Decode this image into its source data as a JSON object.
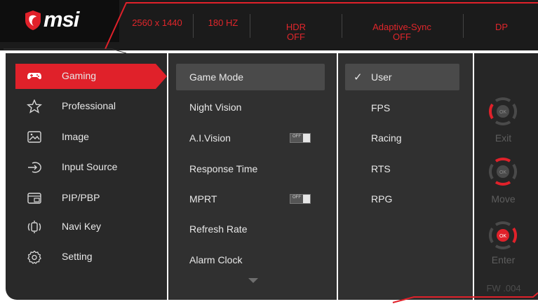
{
  "brand": {
    "logo_text": "msi",
    "accent_color": "#e0212a"
  },
  "header": {
    "specs": [
      {
        "line1": "2560 x 1440",
        "line2": ""
      },
      {
        "line1": "180 HZ",
        "line2": ""
      },
      {
        "line1": "HDR",
        "line2": "OFF"
      },
      {
        "line1": "Adaptive-Sync",
        "line2": "OFF"
      },
      {
        "line1": "DP",
        "line2": ""
      }
    ]
  },
  "main_menu": {
    "items": [
      {
        "label": "Gaming",
        "icon": "gamepad-icon",
        "active": true
      },
      {
        "label": "Professional",
        "icon": "star-icon",
        "active": false
      },
      {
        "label": "Image",
        "icon": "image-icon",
        "active": false
      },
      {
        "label": "Input Source",
        "icon": "input-source-icon",
        "active": false
      },
      {
        "label": "PIP/PBP",
        "icon": "pip-icon",
        "active": false
      },
      {
        "label": "Navi Key",
        "icon": "navi-key-icon",
        "active": false
      },
      {
        "label": "Setting",
        "icon": "gear-icon",
        "active": false
      }
    ]
  },
  "submenu": {
    "items": [
      {
        "label": "Game Mode",
        "selected": true
      },
      {
        "label": "Night Vision"
      },
      {
        "label": "A.I.Vision",
        "toggle": "OFF"
      },
      {
        "label": "Response Time"
      },
      {
        "label": "MPRT",
        "toggle": "OFF"
      },
      {
        "label": "Refresh Rate"
      },
      {
        "label": "Alarm Clock"
      }
    ],
    "more_indicator": "chevron-down-icon"
  },
  "options": {
    "items": [
      {
        "label": "User",
        "checked": true
      },
      {
        "label": "FPS"
      },
      {
        "label": "Racing"
      },
      {
        "label": "RTS"
      },
      {
        "label": "RPG"
      }
    ]
  },
  "keys": {
    "exit_label": "Exit",
    "move_label": "Move",
    "enter_label": "Enter",
    "ok_text": "OK"
  },
  "firmware": "FW .004"
}
